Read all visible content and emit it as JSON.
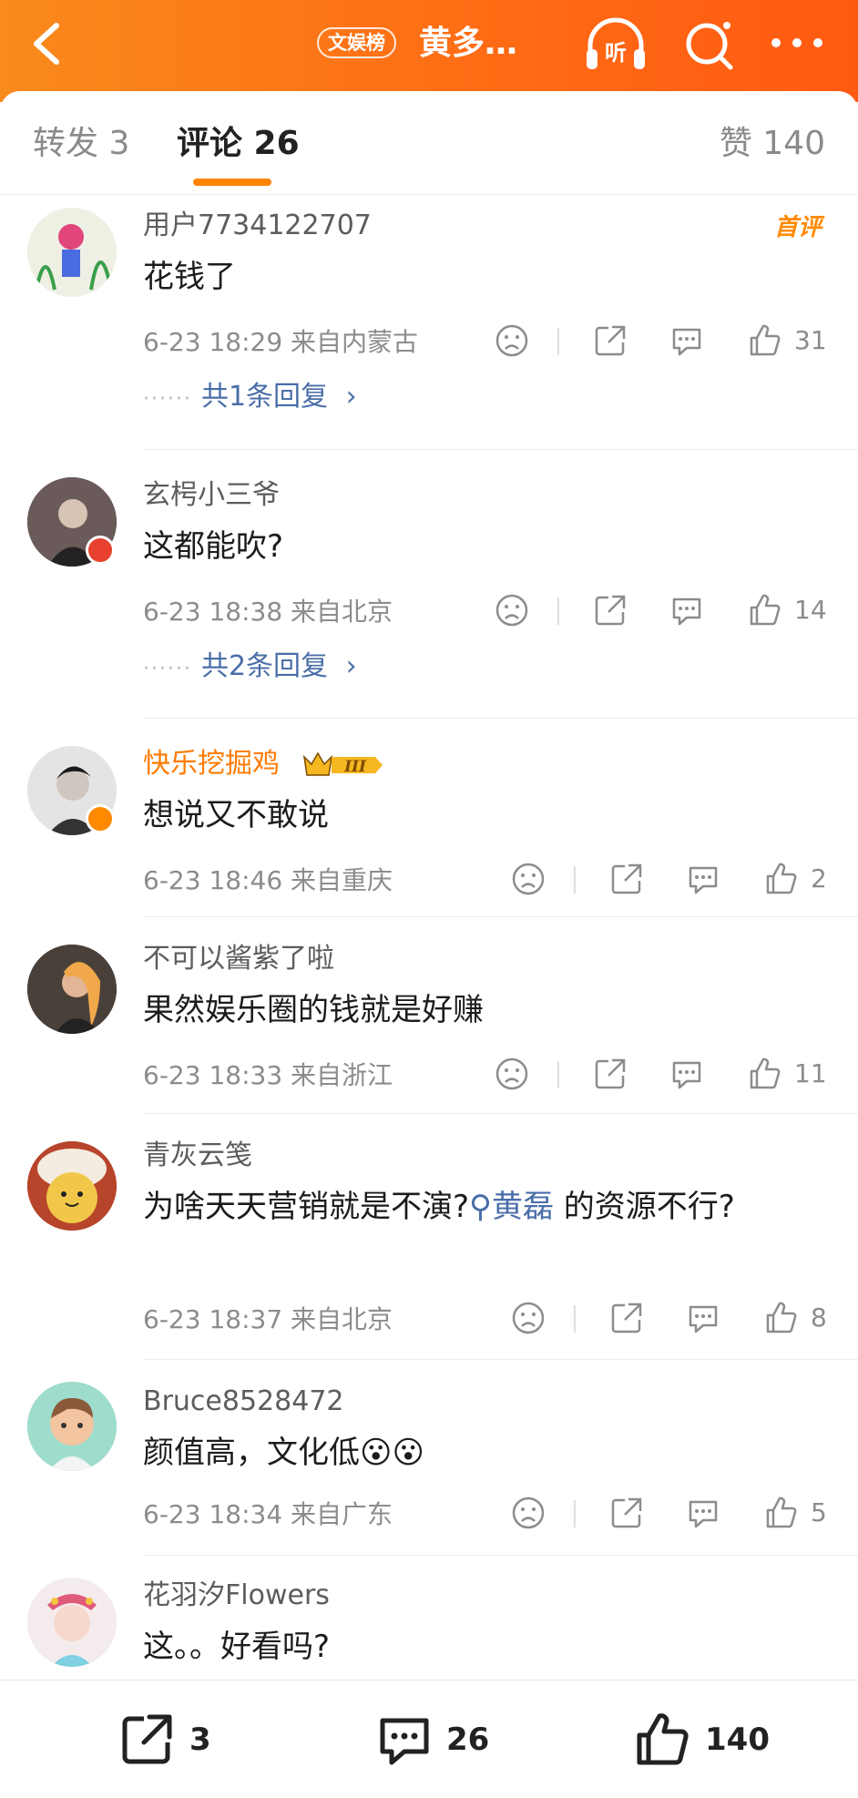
{
  "header": {
    "badge": "文娱榜",
    "title": "黄多…",
    "listen_label": "听",
    "background": "#ff6a14"
  },
  "tabs": {
    "repost": "转发 3",
    "comment": "评论 26",
    "likes": "赞 140",
    "accent": "#ff8200"
  },
  "comments": [
    {
      "username": "用户7734122707",
      "text": "花钱了",
      "time": "6-23 18:29",
      "location": "来自内蒙古",
      "likes": "31",
      "replies": "共1条回复",
      "first_label": "首评",
      "avatar_icon": "avatar-drawing"
    },
    {
      "username": "玄枵小三爷",
      "text": "这都能吹?",
      "time": "6-23 18:38",
      "location": "来自北京",
      "likes": "14",
      "replies": "共2条回复",
      "avatar_icon": "avatar-person"
    },
    {
      "username": "快乐挖掘鸡",
      "vip_label": "III",
      "text": "想说又不敢说",
      "time": "6-23 18:46",
      "location": "来自重庆",
      "likes": "2",
      "avatar_icon": "avatar-person"
    },
    {
      "username": "不可以酱紫了啦",
      "text": "果然娱乐圈的钱就是好赚",
      "time": "6-23 18:33",
      "location": "来自浙江",
      "likes": "11",
      "avatar_icon": "avatar-person"
    },
    {
      "username": "青灰云笺",
      "text_before": "为啥天天营销就是不演?",
      "topic": "黄磊",
      "text_after": " 的资源不行?",
      "time": "6-23 18:37",
      "location": "来自北京",
      "likes": "8",
      "avatar_icon": "avatar-plush"
    },
    {
      "username": "Bruce8528472",
      "text": "颜值高，文化低😮😮",
      "time": "6-23 18:34",
      "location": "来自广东",
      "likes": "5",
      "avatar_icon": "avatar-cartoon"
    },
    {
      "username": "花羽汐Flowers",
      "text": "这。。好看吗?",
      "avatar_icon": "avatar-person"
    }
  ],
  "bottombar": {
    "repost_count": "3",
    "comment_count": "26",
    "like_count": "140"
  }
}
